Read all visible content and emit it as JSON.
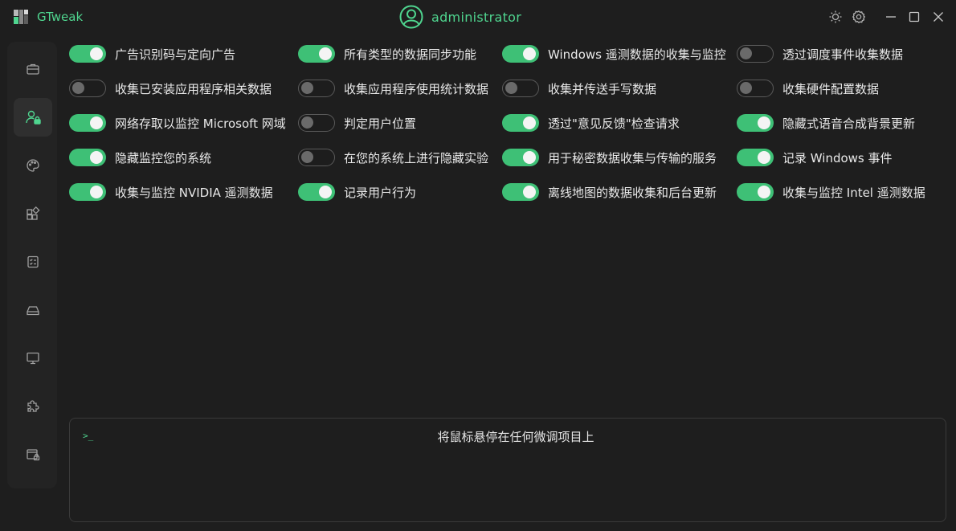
{
  "app": {
    "title": "GTweak",
    "user": "administrator"
  },
  "colors": {
    "accent": "#4fd58f",
    "toggle_on": "#3ec076",
    "background": "#1e1e1e"
  },
  "window_controls": [
    "brightness-icon",
    "settings-icon",
    "minimize-icon",
    "maximize-icon",
    "close-icon"
  ],
  "sidebar": {
    "items": [
      {
        "icon": "briefcase-icon",
        "active": false
      },
      {
        "icon": "user-lock-icon",
        "active": true
      },
      {
        "icon": "palette-icon",
        "active": false
      },
      {
        "icon": "apps-icon",
        "active": false
      },
      {
        "icon": "checklist-icon",
        "active": false
      },
      {
        "icon": "drive-icon",
        "active": false
      },
      {
        "icon": "monitor-icon",
        "active": false
      },
      {
        "icon": "puzzle-icon",
        "active": false
      },
      {
        "icon": "window-lock-icon",
        "active": false
      }
    ]
  },
  "toggles": [
    [
      {
        "label": "广告识别码与定向广告",
        "on": true
      },
      {
        "label": "收集已安装应用程序相关数据",
        "on": false
      },
      {
        "label": "网络存取以监控 Microsoft 网域",
        "on": true
      },
      {
        "label": "隐藏监控您的系统",
        "on": true
      },
      {
        "label": "收集与监控 NVIDIA 遥测数据",
        "on": true
      }
    ],
    [
      {
        "label": "所有类型的数据同步功能",
        "on": true
      },
      {
        "label": "收集应用程序使用统计数据",
        "on": false
      },
      {
        "label": "判定用户位置",
        "on": false
      },
      {
        "label": "在您的系统上进行隐藏实验",
        "on": false
      },
      {
        "label": "记录用户行为",
        "on": true
      }
    ],
    [
      {
        "label": "Windows 遥测数据的收集与监控",
        "on": true
      },
      {
        "label": "收集并传送手写数据",
        "on": false
      },
      {
        "label": "透过\"意见反馈\"检查请求",
        "on": true
      },
      {
        "label": "用于秘密数据收集与传输的服务",
        "on": true
      },
      {
        "label": "离线地图的数据收集和后台更新",
        "on": true
      }
    ],
    [
      {
        "label": "透过调度事件收集数据",
        "on": false
      },
      {
        "label": "收集硬件配置数据",
        "on": false
      },
      {
        "label": "隐藏式语音合成背景更新",
        "on": true
      },
      {
        "label": "记录 Windows 事件",
        "on": true
      },
      {
        "label": "收集与监控 Intel 遥测数据",
        "on": true
      }
    ]
  ],
  "console": {
    "prompt": ">_",
    "hint": "将鼠标悬停在任何微调项目上"
  }
}
